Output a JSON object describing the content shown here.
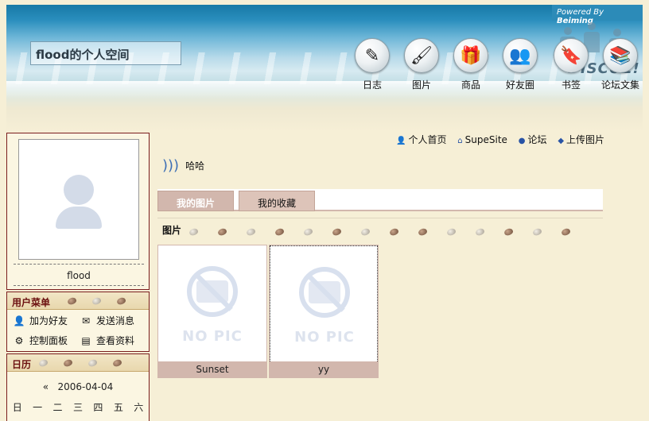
{
  "header": {
    "space_title": "flood的个人空间",
    "powered_by_prefix": "Powered By",
    "powered_by_brand": "Beiming",
    "watermark": "DISCUZ!",
    "nav": [
      {
        "label": "日志",
        "icon": "pencil-paper-icon"
      },
      {
        "label": "图片",
        "icon": "paintbrush-icon"
      },
      {
        "label": "商品",
        "icon": "gift-box-icon"
      },
      {
        "label": "好友圈",
        "icon": "friends-icon"
      },
      {
        "label": "书签",
        "icon": "bookmark-icon"
      },
      {
        "label": "论坛文集",
        "icon": "forum-collection-icon"
      }
    ]
  },
  "profile": {
    "username": "flood"
  },
  "user_menu": {
    "title": "用户菜单",
    "items": [
      {
        "label": "加为好友",
        "icon": "add-friend-icon"
      },
      {
        "label": "发送消息",
        "icon": "envelope-icon"
      },
      {
        "label": "控制面板",
        "icon": "gear-icon"
      },
      {
        "label": "查看资料",
        "icon": "profile-card-icon"
      }
    ]
  },
  "calendar": {
    "title": "日历",
    "prev": "«",
    "date": "2006-04-04",
    "weekdays": [
      "日",
      "一",
      "二",
      "三",
      "四",
      "五",
      "六"
    ]
  },
  "top_links": [
    {
      "label": "个人首页",
      "icon": "person-icon"
    },
    {
      "label": "SupeSite",
      "icon": "home-icon"
    },
    {
      "label": "论坛",
      "icon": "chat-bubble-icon"
    },
    {
      "label": "上传图片",
      "icon": "upload-icon"
    }
  ],
  "status": {
    "text": "哈哈",
    "icon": "sound-wave-icon"
  },
  "tabs": {
    "my_pictures": "我的图片",
    "my_favorites": "我的收藏"
  },
  "section": {
    "label": "图片"
  },
  "pictures": [
    {
      "name": "Sunset",
      "placeholder": "NO PIC"
    },
    {
      "name": "yy",
      "placeholder": "NO PIC"
    }
  ]
}
